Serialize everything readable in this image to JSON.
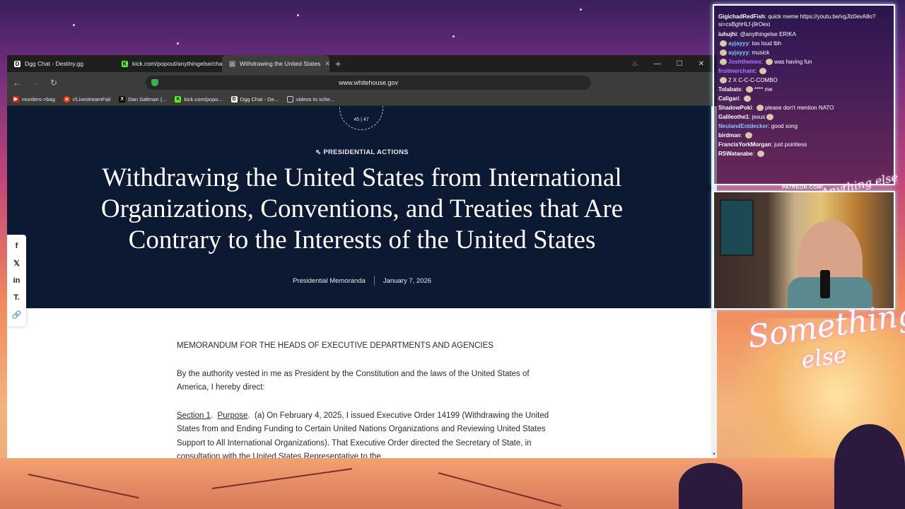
{
  "browser": {
    "tabs": [
      {
        "label": "Dgg Chat - Destiny.gg",
        "icon": "destiny-icon",
        "active": false
      },
      {
        "label": "kick.com/popout/anythingelse/chat",
        "icon": "kick-icon",
        "active": false
      },
      {
        "label": "Withdrawing the United States",
        "icon": "whitehouse-icon",
        "active": true
      }
    ],
    "new_tab": "+",
    "url": "www.whitehouse.gov",
    "bookmarks": [
      {
        "label": "murders->bag",
        "icon": "youtube-icon"
      },
      {
        "label": "r/LivestreamFail",
        "icon": "reddit-icon"
      },
      {
        "label": "Dan Saltman (...",
        "icon": "x-icon"
      },
      {
        "label": "kick.com/popo...",
        "icon": "kick-icon"
      },
      {
        "label": "Dgg Chat - De...",
        "icon": "destiny-icon"
      },
      {
        "label": "videos to sche...",
        "icon": "folder-icon"
      }
    ]
  },
  "page": {
    "seal_numbers": "45 | 47",
    "category": "PRESIDENTIAL ACTIONS",
    "title": "Withdrawing the United States from International Organizations, Conventions, and Treaties that Are Contrary to the Interests of the United States",
    "type": "Presidential Memoranda",
    "date": "January 7, 2026",
    "memo_heading": "MEMORANDUM FOR THE HEADS OF EXECUTIVE DEPARTMENTS AND AGENCIES",
    "intro": "By the authority vested in me as President by the Constitution and the laws of the United States of America, I hereby direct:",
    "section_label": "Section 1",
    "section_title": "Purpose",
    "section_text": "(a)  On February 4, 2025, I issued Executive Order 14199 (Withdrawing the United States from and Ending Funding to Certain United Nations Organizations and Reviewing United States Support to All International Organizations).  That Executive Order directed the Secretary of State, in consultation with the United States Representative to the"
  },
  "chat": {
    "messages": [
      {
        "user": "GigichadRedFish",
        "text": "quick meme https://youtu.be/vgJlz0evA8o?si=csBghHLf-j9rOexi",
        "color": "#ffffff"
      },
      {
        "user": "iuhujhi",
        "text": "@anythingelse ERIKA",
        "color": "#ffffff"
      },
      {
        "user": "ayjayyy",
        "text": "too loud tbh",
        "color": "#7cc8ff"
      },
      {
        "user": "ayjayyy",
        "text": "musick",
        "color": "#7cc8ff"
      },
      {
        "user": "Joshthemex",
        "text": "was having fun",
        "color": "#b07cff"
      },
      {
        "user": "fruitmerchant",
        "text": "",
        "color": "#b07cff"
      },
      {
        "user": "",
        "text": "2 X C-C-C-COMBO",
        "color": "#ffffff"
      },
      {
        "user": "Tolabats",
        "text": "**** me",
        "color": "#ffffff"
      },
      {
        "user": "Caligari",
        "text": "",
        "color": "#ffffff"
      },
      {
        "user": "ShadowPoki",
        "text": "please don't mention NATO",
        "color": "#ffffff"
      },
      {
        "user": "Galileothe1",
        "text": "jesus",
        "color": "#ffffff"
      },
      {
        "user": "NeulandEntdecker",
        "text": "good song",
        "color": "#7cc8ff"
      },
      {
        "user": "birdman",
        "text": "",
        "color": "#ffffff"
      },
      {
        "user": "FrancisYorkMorgan",
        "text": "just pointless",
        "color": "#ffffff"
      },
      {
        "user": "RSWatanabe",
        "text": "",
        "color": "#ffffff"
      }
    ]
  },
  "overlay": {
    "patreon": "PATREON.COM/",
    "brand_small": "Anything else",
    "signature_1": "Something",
    "signature_2": "else"
  }
}
